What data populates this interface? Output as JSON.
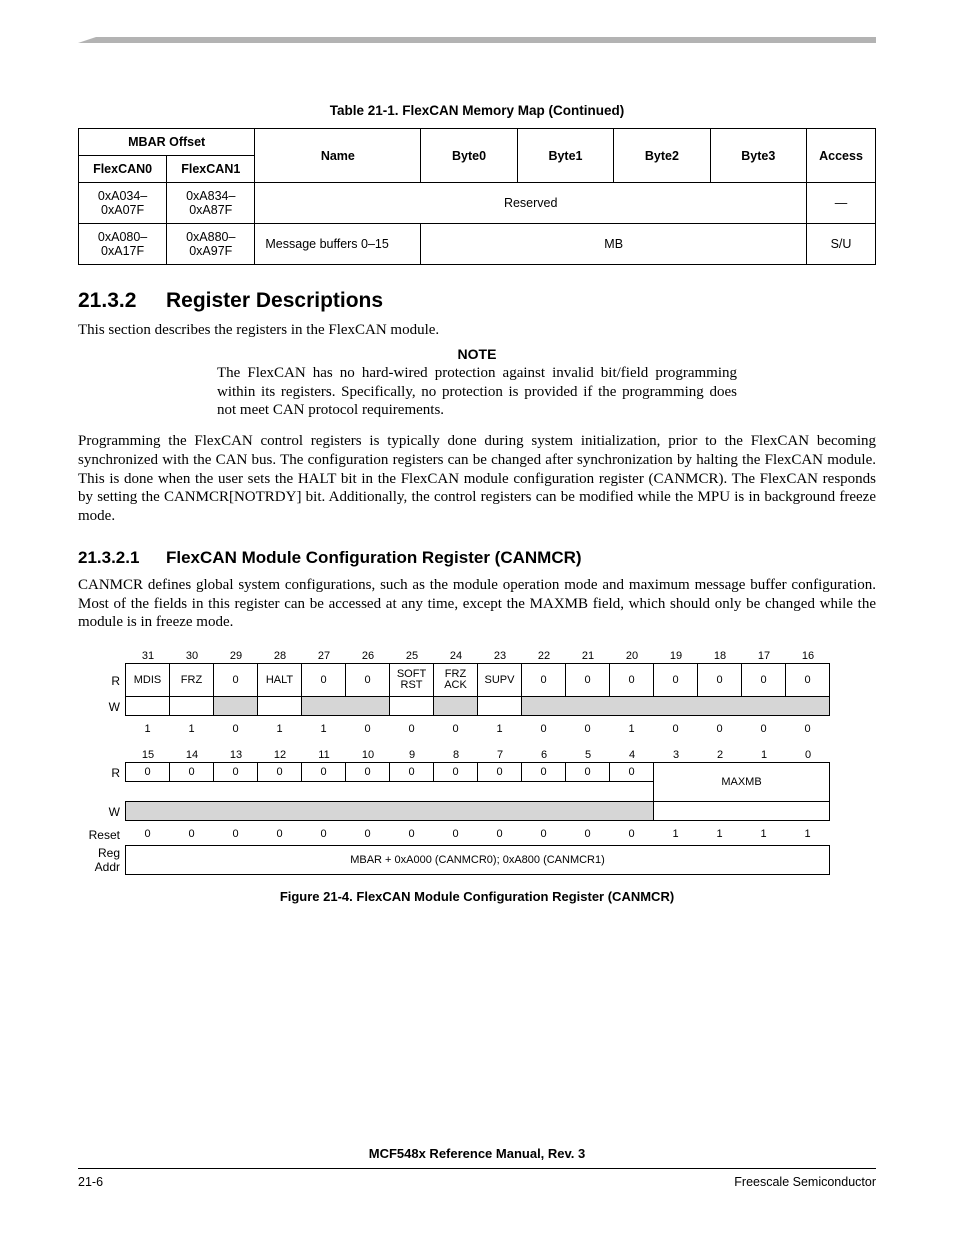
{
  "table": {
    "caption": "Table 21-1. FlexCAN Memory Map  (Continued)",
    "headers": {
      "mbar": "MBAR Offset",
      "flexcan0": "FlexCAN0",
      "flexcan1": "FlexCAN1",
      "name": "Name",
      "byte0": "Byte0",
      "byte1": "Byte1",
      "byte2": "Byte2",
      "byte3": "Byte3",
      "access": "Access"
    },
    "rows": [
      {
        "c0": "0xA034–0xA07F",
        "c1": "0xA834–0xA87F",
        "span": "Reserved",
        "access": "—"
      },
      {
        "c0": "0xA080–0xA17F",
        "c1": "0xA880–0xA97F",
        "name": "Message buffers 0–15",
        "bytes": "MB",
        "access": "S/U"
      }
    ]
  },
  "sections": {
    "s1_num": "21.3.2",
    "s1_title": "Register Descriptions",
    "s1_p1": "This section describes the registers in the FlexCAN module.",
    "note_title": "NOTE",
    "note_body": "The FlexCAN has no hard-wired protection against invalid bit/field programming within its registers. Specifically, no protection is provided if the programming does not meet CAN protocol requirements.",
    "s1_p2": "Programming the FlexCAN control registers is typically done during system initialization, prior to the FlexCAN becoming synchronized with the CAN bus. The configuration registers can be changed after synchronization by halting the FlexCAN module. This is done when the user sets the HALT bit in the FlexCAN module configuration register (CANMCR). The FlexCAN responds by setting the CANMCR[NOTRDY] bit. Additionally, the control registers can be modified while the MPU is in background freeze mode.",
    "s2_num": "21.3.2.1",
    "s2_title": "FlexCAN Module Configuration Register (CANMCR)",
    "s2_p1": "CANMCR defines global system configurations, such as the module operation mode and maximum message buffer configuration. Most of the fields in this register can be accessed at any time, except the MAXMB field, which should only be changed while the module is in freeze mode."
  },
  "register": {
    "bits_hi": [
      "31",
      "30",
      "29",
      "28",
      "27",
      "26",
      "25",
      "24",
      "23",
      "22",
      "21",
      "20",
      "19",
      "18",
      "17",
      "16"
    ],
    "bits_lo": [
      "15",
      "14",
      "13",
      "12",
      "11",
      "10",
      "9",
      "8",
      "7",
      "6",
      "5",
      "4",
      "3",
      "2",
      "1",
      "0"
    ],
    "row_labels": {
      "r": "R",
      "w": "W",
      "reset": "Reset",
      "regaddr": "Reg Addr"
    },
    "r_hi": [
      "MDIS",
      "FRZ",
      "0",
      "HALT",
      "0",
      "0",
      "SOFT RST",
      "FRZ ACK",
      "SUPV",
      "0",
      "0",
      "0",
      "0",
      "0",
      "0",
      "0"
    ],
    "reset_hi": [
      "1",
      "1",
      "0",
      "1",
      "1",
      "0",
      "0",
      "0",
      "1",
      "0",
      "0",
      "1",
      "0",
      "0",
      "0",
      "0"
    ],
    "r_lo": [
      "0",
      "0",
      "0",
      "0",
      "0",
      "0",
      "0",
      "0",
      "0",
      "0",
      "0",
      "0"
    ],
    "maxmb_label": "MAXMB",
    "reset_lo": [
      "0",
      "0",
      "0",
      "0",
      "0",
      "0",
      "0",
      "0",
      "0",
      "0",
      "0",
      "0",
      "1",
      "1",
      "1",
      "1"
    ],
    "regaddr": "MBAR + 0xA000 (CANMCR0); 0xA800 (CANMCR1)",
    "reset_label_spacer": ""
  },
  "figure_caption": "Figure 21-4. FlexCAN Module Configuration Register (CANMCR)",
  "footer": {
    "title": "MCF548x Reference Manual, Rev. 3",
    "left": "21-6",
    "right": "Freescale Semiconductor"
  }
}
